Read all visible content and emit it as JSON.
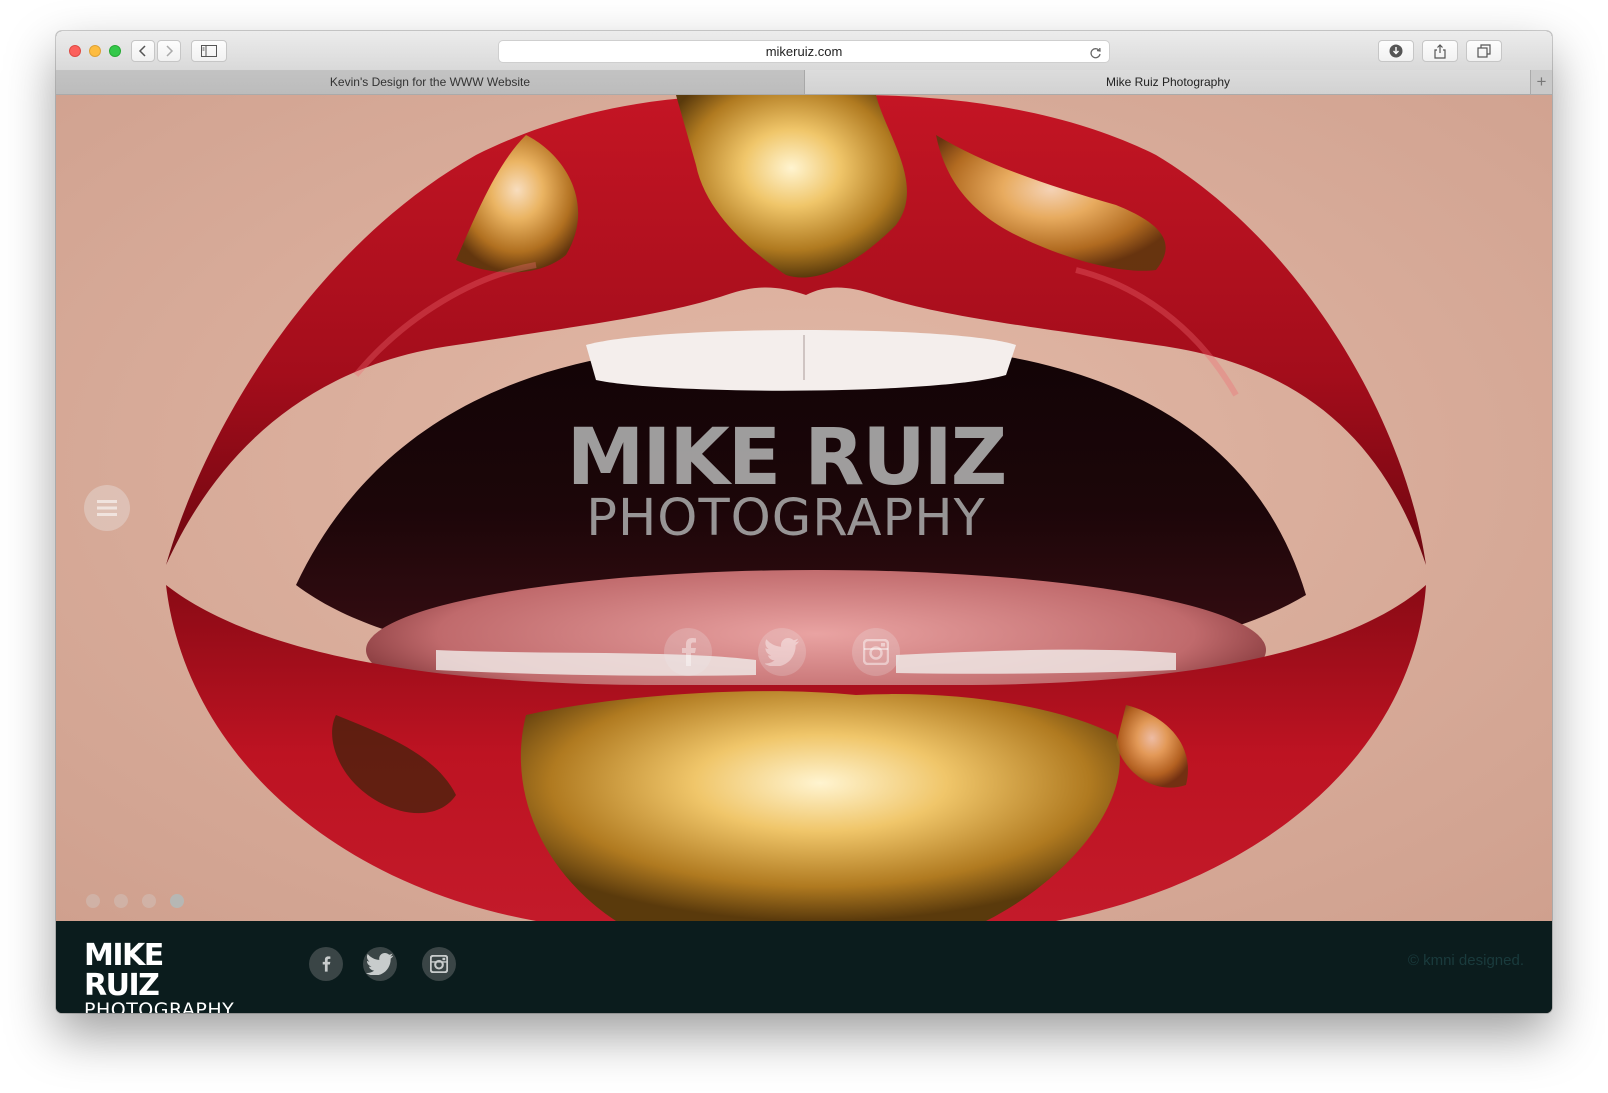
{
  "browser": {
    "url": "mikeruiz.com",
    "tabs": [
      {
        "label": "Kevin's Design for the WWW Website",
        "active": false
      },
      {
        "label": "Mike Ruiz Photography",
        "active": true
      }
    ],
    "new_tab_label": "+"
  },
  "hero": {
    "title_line1": "MIKE RUIZ",
    "title_line2": "PHOTOGRAPHY",
    "social_icons": [
      "facebook-icon",
      "twitter-icon",
      "instagram-icon"
    ],
    "slides_total": 4,
    "slide_active": 4
  },
  "footer": {
    "logo_line1": "MIKE RUIZ",
    "logo_line2": "PHOTOGRAPHY",
    "social_icons": [
      "facebook-icon",
      "twitter-icon",
      "instagram-icon"
    ],
    "copyright": "© kmni designed."
  },
  "colors": {
    "footer_bg": "#0b1c1d",
    "lip_red": "#b5101e",
    "gold": "#d8a640"
  }
}
